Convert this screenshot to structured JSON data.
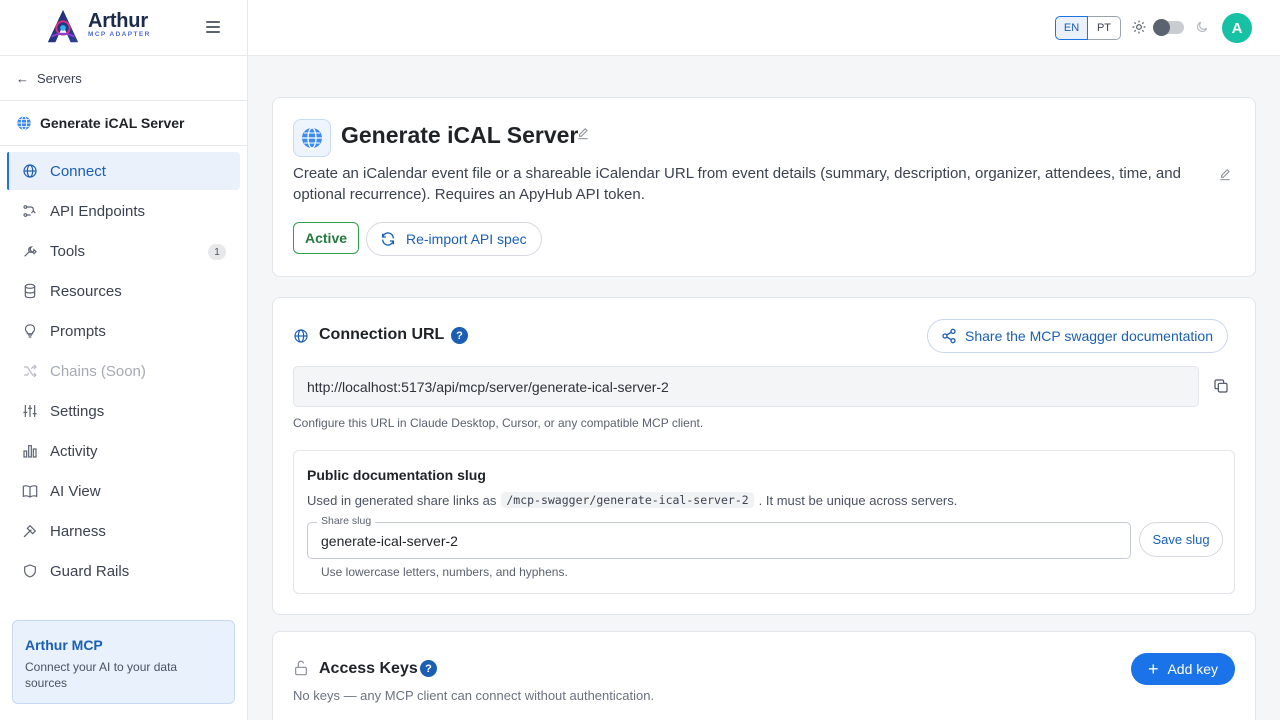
{
  "brand": {
    "name": "Arthur",
    "subtitle": "MCP ADAPTER"
  },
  "sidebar": {
    "back_label": "Servers",
    "server_name": "Generate iCAL Server",
    "items": [
      {
        "label": "Connect",
        "icon": "globe-icon"
      },
      {
        "label": "API Endpoints",
        "icon": "endpoints-icon"
      },
      {
        "label": "Tools",
        "icon": "tools-icon",
        "badge": "1"
      },
      {
        "label": "Resources",
        "icon": "database-icon"
      },
      {
        "label": "Prompts",
        "icon": "lightbulb-icon"
      },
      {
        "label": "Chains (Soon)",
        "icon": "shuffle-icon"
      },
      {
        "label": "Settings",
        "icon": "sliders-icon"
      },
      {
        "label": "Activity",
        "icon": "bar-chart-icon"
      },
      {
        "label": "AI View",
        "icon": "book-icon"
      },
      {
        "label": "Harness",
        "icon": "harness-icon"
      },
      {
        "label": "Guard Rails",
        "icon": "shield-icon"
      }
    ],
    "promo": {
      "title": "Arthur MCP",
      "text": "Connect your AI to your data sources"
    }
  },
  "topbar": {
    "lang_en": "EN",
    "lang_pt": "PT",
    "avatar_initial": "A"
  },
  "server": {
    "title": "Generate iCAL Server",
    "description": "Create an iCalendar event file or a shareable iCalendar URL from event details (summary, description, organizer, attendees, time, and optional recurrence). Requires an ApyHub API token.",
    "status": "Active",
    "reimport_label": "Re-import API spec"
  },
  "connection": {
    "title": "Connection URL",
    "share_label": "Share the MCP swagger documentation",
    "url": "http://localhost:5173/api/mcp/server/generate-ical-server-2",
    "hint": "Configure this URL in Claude Desktop, Cursor, or any compatible MCP client.",
    "slug": {
      "title": "Public documentation slug",
      "desc_before": "Used in generated share links as",
      "desc_code": "/mcp-swagger/generate-ical-server-2",
      "desc_after": ". It must be unique across servers.",
      "label": "Share slug",
      "value": "generate-ical-server-2",
      "save_label": "Save slug",
      "hint": "Use lowercase letters, numbers, and hyphens."
    }
  },
  "access_keys": {
    "title": "Access Keys",
    "add_label": "Add key",
    "hint": "No keys — any MCP client can connect without authentication."
  },
  "colors": {
    "accent": "#1a73e8",
    "active_status": "#2e9e4f",
    "avatar": "#16c2a3"
  }
}
